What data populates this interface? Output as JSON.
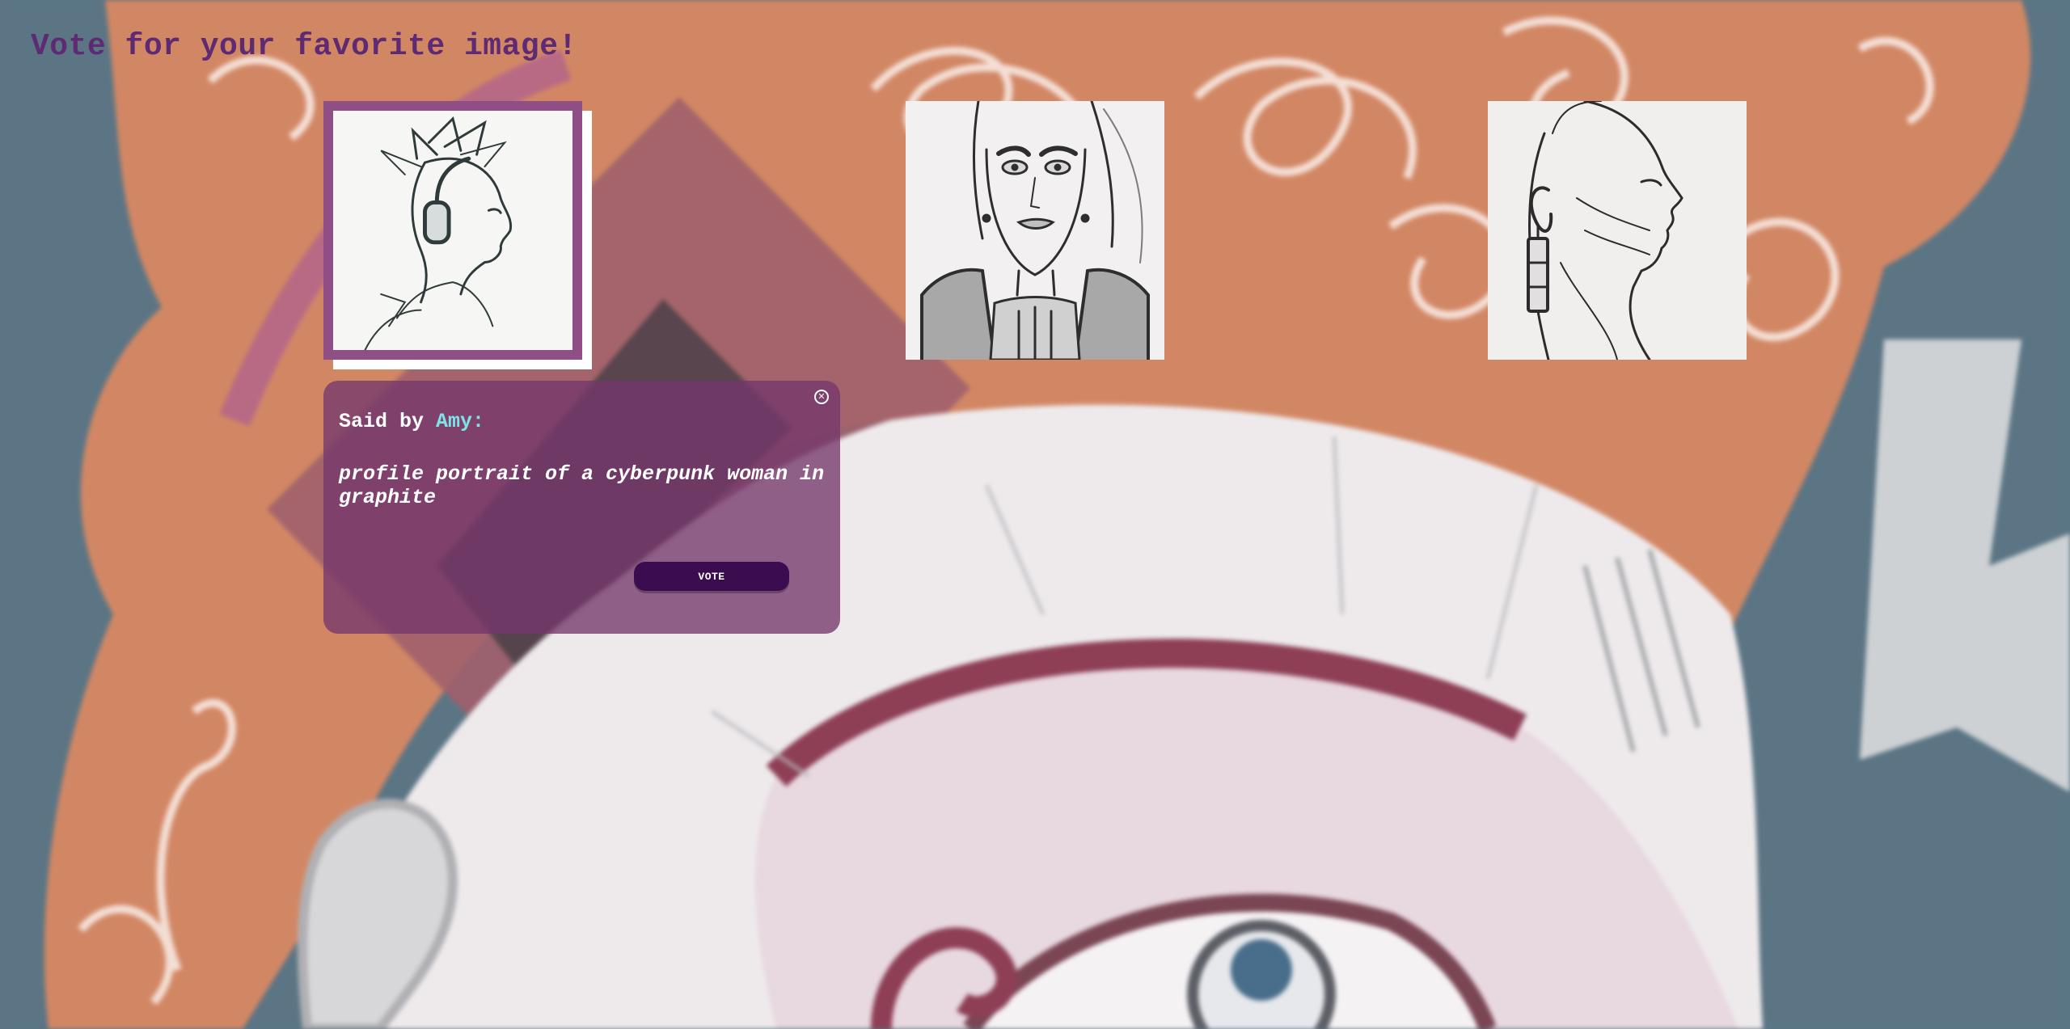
{
  "page": {
    "title": "Vote for your favorite image!"
  },
  "gallery": {
    "images": [
      {
        "icon": "cyberpunk-profile-sketch",
        "selected": true
      },
      {
        "icon": "cyberpunk-front-portrait-sketch",
        "selected": false
      },
      {
        "icon": "cyberpunk-side-profile-sketch",
        "selected": false
      }
    ]
  },
  "popup": {
    "said_by_prefix": "Said by ",
    "author": "Amy",
    "said_by_suffix": ":",
    "prompt": "profile portrait of a cyberpunk woman in graphite",
    "vote_label": "VOTE",
    "close_icon": "close-icon"
  },
  "colors": {
    "title": "#5e2a73",
    "selection_border": "#8f4f86",
    "popup_bg": "#74376c",
    "author": "#7fe3e6",
    "vote_button": "#3c0c50"
  }
}
